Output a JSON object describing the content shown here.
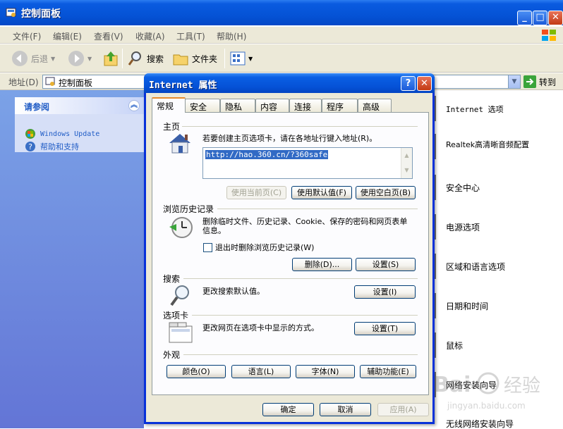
{
  "cp": {
    "title": "控制面板",
    "menu": [
      "文件(F)",
      "编辑(E)",
      "查看(V)",
      "收藏(A)",
      "工具(T)",
      "帮助(H)"
    ],
    "toolbar": {
      "back": "后退",
      "search": "搜索",
      "folders": "文件夹"
    },
    "address": {
      "label": "地址(D)",
      "value": "控制面板",
      "go": "转到"
    },
    "see_also": {
      "title": "请参阅",
      "links": [
        "Windows Update",
        "帮助和支持"
      ]
    },
    "items": [
      "Internet 选项",
      "Realtek高清晰音频配置",
      "安全中心",
      "电源选项",
      "区域和语言选项",
      "日期和时间",
      "鼠标",
      "网络安装向导",
      "无线网络安装向导"
    ]
  },
  "dialog": {
    "title": "Internet 属性",
    "help": "?",
    "close": "✕",
    "tabs": [
      "常规",
      "安全",
      "隐私",
      "内容",
      "连接",
      "程序",
      "高级"
    ],
    "home": {
      "heading": "主页",
      "desc": "若要创建主页选项卡，请在各地址行键入地址(R)。",
      "url": "http://hao.360.cn/?360safe",
      "use_current": "使用当前页(C)",
      "use_default": "使用默认值(F)",
      "use_blank": "使用空白页(B)"
    },
    "history": {
      "heading": "浏览历史记录",
      "desc": "删除临时文件、历史记录、Cookie、保存的密码和网页表单信息。",
      "checkbox": "退出时删除浏览历史记录(W)",
      "delete": "删除(D)...",
      "settings": "设置(S)"
    },
    "search": {
      "heading": "搜索",
      "desc": "更改搜索默认值。",
      "settings": "设置(I)"
    },
    "tabs_group": {
      "heading": "选项卡",
      "desc": "更改网页在选项卡中显示的方式。",
      "settings": "设置(T)"
    },
    "appearance": {
      "heading": "外观",
      "colors": "颜色(O)",
      "languages": "语言(L)",
      "fonts": "字体(N)",
      "accessibility": "辅助功能(E)"
    },
    "footer": {
      "ok": "确定",
      "cancel": "取消",
      "apply": "应用(A)"
    }
  },
  "watermark": "Bai 经验 jingyan.baidu.com",
  "colors": {
    "xp_blue": "#0553d6",
    "sidebar": "#6375d6",
    "dialog_bg": "#ece9d8",
    "selection": "#316ac5"
  }
}
